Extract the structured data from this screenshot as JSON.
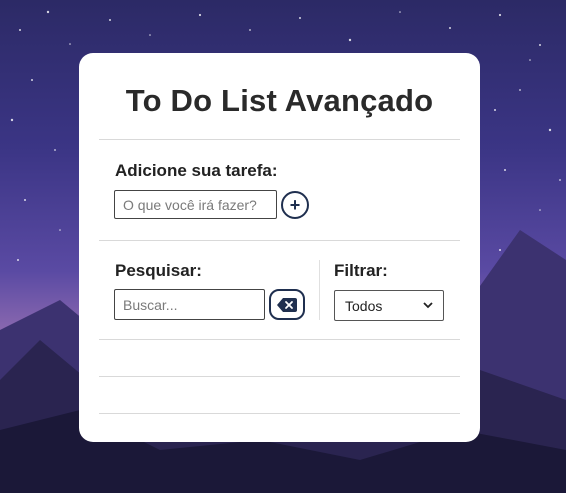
{
  "header": {
    "title": "To Do List Avançado"
  },
  "add_task": {
    "label": "Adicione sua tarefa:",
    "placeholder": "O que você irá fazer?",
    "button_symbol": "+"
  },
  "search": {
    "label": "Pesquisar:",
    "placeholder": "Buscar..."
  },
  "filter": {
    "label": "Filtrar:",
    "selected": "Todos"
  },
  "icons": {
    "add": "plus-icon",
    "clear": "backspace-icon",
    "dropdown": "chevron-down-icon"
  },
  "colors": {
    "button_border": "#1f2f4f",
    "card_background": "#ffffff"
  }
}
